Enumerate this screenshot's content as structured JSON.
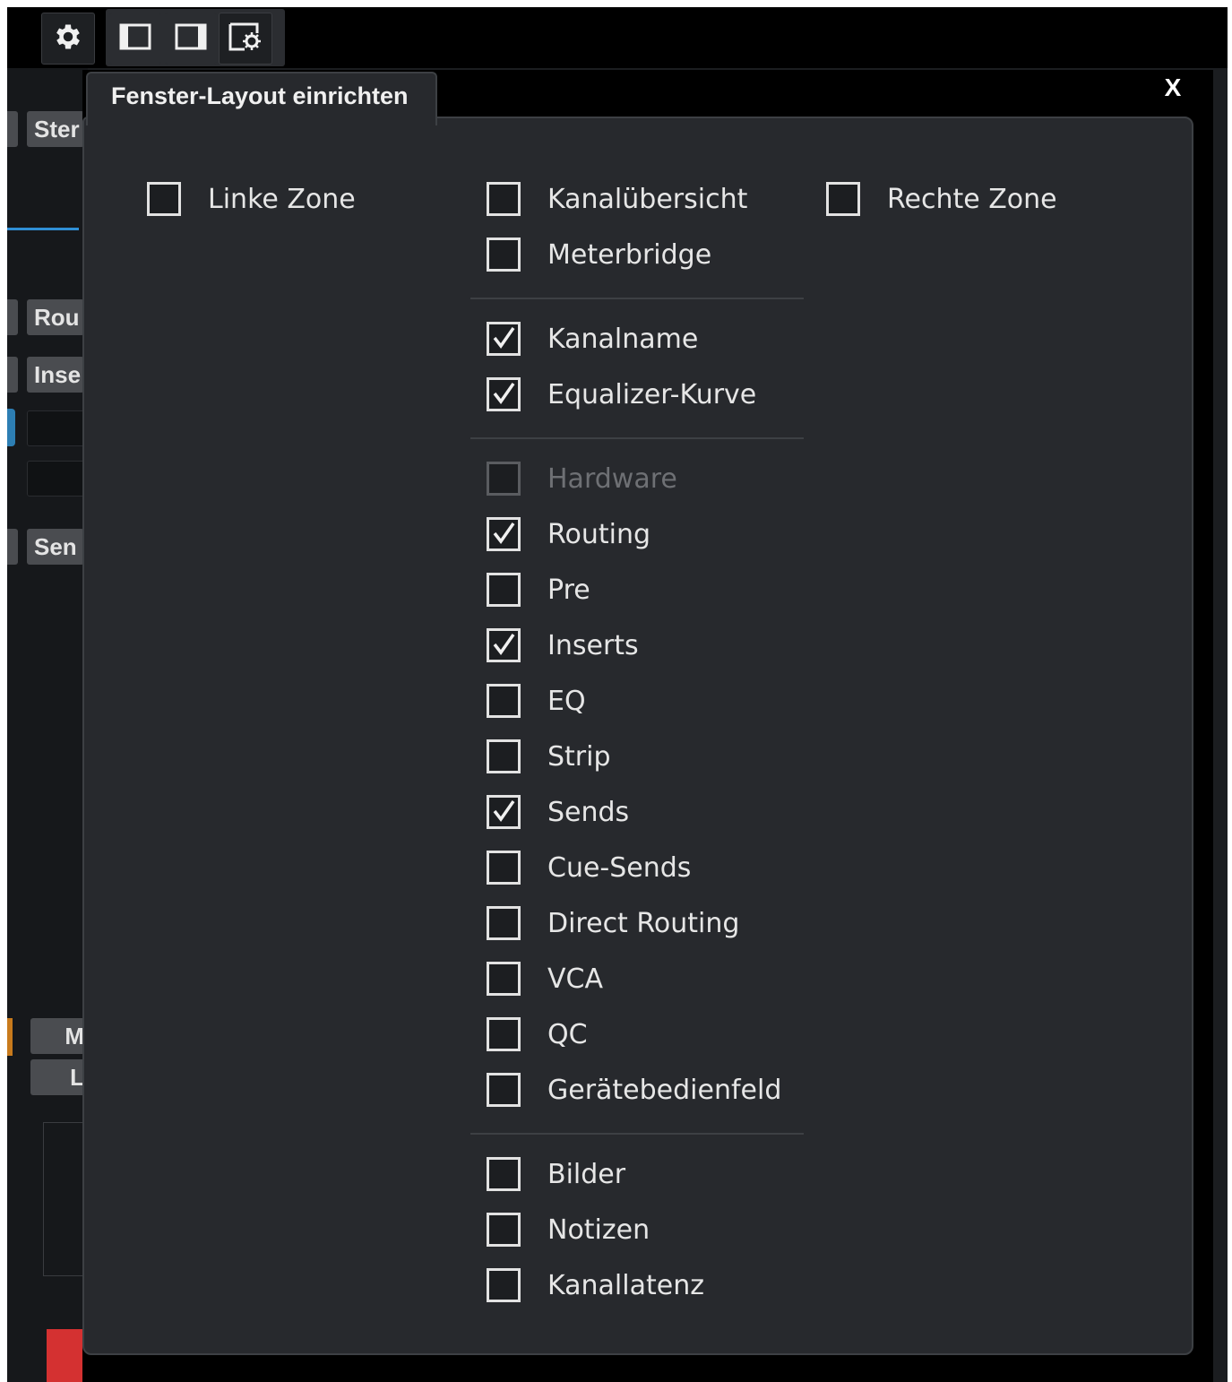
{
  "dialog": {
    "title": "Fenster-Layout einrichten",
    "close_label": "X"
  },
  "background_strip": {
    "buttons": [
      "Ster",
      "Rou",
      "Inse",
      "Sen"
    ],
    "letters": [
      "M",
      "L"
    ]
  },
  "options": {
    "left_zone": {
      "label": "Linke Zone",
      "checked": false
    },
    "right_zone": {
      "label": "Rechte Zone",
      "checked": false
    },
    "overview": [
      {
        "label": "Kanalübersicht",
        "checked": false
      },
      {
        "label": "Meterbridge",
        "checked": false
      }
    ],
    "channel": [
      {
        "label": "Kanalname",
        "checked": true
      },
      {
        "label": "Equalizer-Kurve",
        "checked": true
      }
    ],
    "sections": [
      {
        "label": "Hardware",
        "checked": false,
        "disabled": true
      },
      {
        "label": "Routing",
        "checked": true
      },
      {
        "label": "Pre",
        "checked": false
      },
      {
        "label": "Inserts",
        "checked": true
      },
      {
        "label": "EQ",
        "checked": false
      },
      {
        "label": "Strip",
        "checked": false
      },
      {
        "label": "Sends",
        "checked": true
      },
      {
        "label": "Cue-Sends",
        "checked": false
      },
      {
        "label": "Direct Routing",
        "checked": false
      },
      {
        "label": "VCA",
        "checked": false
      },
      {
        "label": "QC",
        "checked": false
      },
      {
        "label": "Gerätebedienfeld",
        "checked": false
      }
    ],
    "extras": [
      {
        "label": "Bilder",
        "checked": false
      },
      {
        "label": "Notizen",
        "checked": false
      },
      {
        "label": "Kanallatenz",
        "checked": false
      }
    ]
  },
  "icons": {
    "toolbar": [
      "gear-icon",
      "left-zone-icon",
      "right-zone-icon",
      "window-settings-icon"
    ],
    "check": "check-icon"
  },
  "colors": {
    "background": "#1b1d20",
    "dialog": "#27292d",
    "text": "#e6e6e6",
    "disabled_text": "#6e7074",
    "accent_blue": "#2f8fd6"
  }
}
